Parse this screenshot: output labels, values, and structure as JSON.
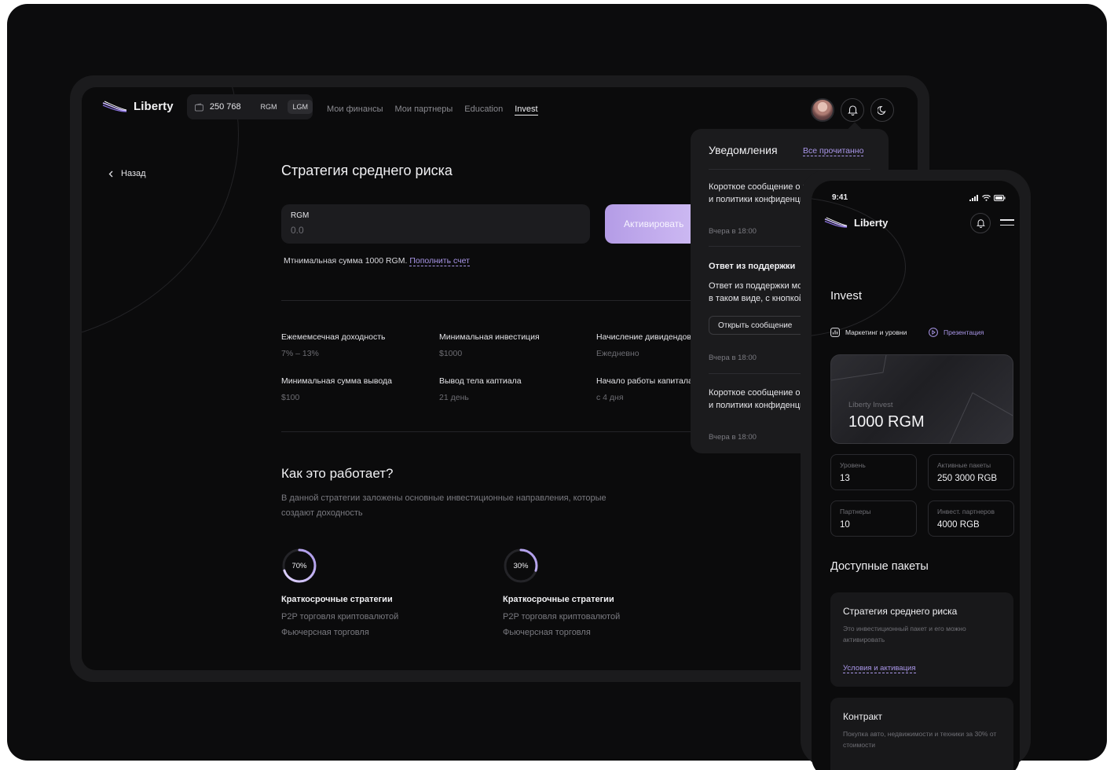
{
  "header": {
    "logo": "Liberty",
    "balance": "250 768",
    "currencies": [
      "RGM",
      "LGM"
    ],
    "active_currency": "LGM",
    "nav": [
      "Мои финансы",
      "Мои партнеры",
      "Education",
      "Invest"
    ],
    "active_nav": "Invest"
  },
  "back_label": "Назад",
  "page_title": "Стратегия среднего риска",
  "amount_field": {
    "label": "RGM",
    "value": "0.0"
  },
  "activate_label": "Активировать",
  "min_note": {
    "text": "Мтнимальная сумма 1000 RGM.",
    "link": "Пополнить счет"
  },
  "stats": [
    {
      "label": "Ежемемсечная доходность",
      "value": "7% – 13%"
    },
    {
      "label": "Минимальная инвестиция",
      "value": "$1000"
    },
    {
      "label": "Начисление дивидендов",
      "value": "Ежедневно"
    },
    {
      "label": "Минимальная сумма вывода",
      "value": "$100"
    },
    {
      "label": "Вывод тела каптиала",
      "value": "21 день"
    },
    {
      "label": "Начало работы капитала",
      "value": "с 4 дня"
    }
  ],
  "how": {
    "title": "Как это работает?",
    "text": "В данной стратегии заложены основные инвестиционные направления, которые создают доходность"
  },
  "strategies": [
    {
      "percent": 70,
      "percent_label": "70%",
      "title": "Краткосрочные стратегии",
      "line1": "P2P торговля криптовалютой",
      "line2": "Фьючерсная торговля"
    },
    {
      "percent": 30,
      "percent_label": "30%",
      "title": "Краткосрочные стратегии",
      "line1": "P2P торговля криптовалютой",
      "line2": "Фьючерсная торговля"
    }
  ],
  "notifications": {
    "title": "Уведомления",
    "mark_all": "Все прочитанно",
    "items": [
      {
        "title": "",
        "body": "Короткое сообщение о новостях компании и политики конфиденциальности",
        "time": "Вчера в 18:00",
        "button": ""
      },
      {
        "title": "Ответ из поддержки",
        "body": "Ответ из поддержки может выглядеть вот в таком виде, с кнопкой",
        "time": "Вчера в 18:00",
        "button": "Открыть сообщение"
      },
      {
        "title": "",
        "body": "Короткое сообщение о новостях компании и политики конфиденциальности",
        "time": "Вчера в 18:00",
        "button": ""
      }
    ]
  },
  "mobile": {
    "time": "9:41",
    "logo": "Liberty",
    "title": "Invest",
    "links": [
      "Маркетинг и уровни",
      "Презентация"
    ],
    "card": {
      "label": "Liberty Invest",
      "value": "1000 RGM"
    },
    "tiles": [
      {
        "label": "Уровень",
        "value": "13"
      },
      {
        "label": "Активные пакеты",
        "value": "250 3000 RGB"
      },
      {
        "label": "Партнеры",
        "value": "10"
      },
      {
        "label": "Инвест. партнеров",
        "value": "4000 RGB"
      }
    ],
    "packages_title": "Доступные пакеты",
    "packages": [
      {
        "title": "Стратегия среднего риска",
        "desc": "Это инвестиционный пакет и его можно активировать",
        "action": "Условия и активация"
      },
      {
        "title": "Контракт",
        "desc": "Покупка авто, недвижимости и техники за 30% от стоимости",
        "action": ""
      }
    ]
  },
  "colors": {
    "accent": "#a996e8",
    "background": "#0b0b0c",
    "panel": "#1b1b1d"
  }
}
